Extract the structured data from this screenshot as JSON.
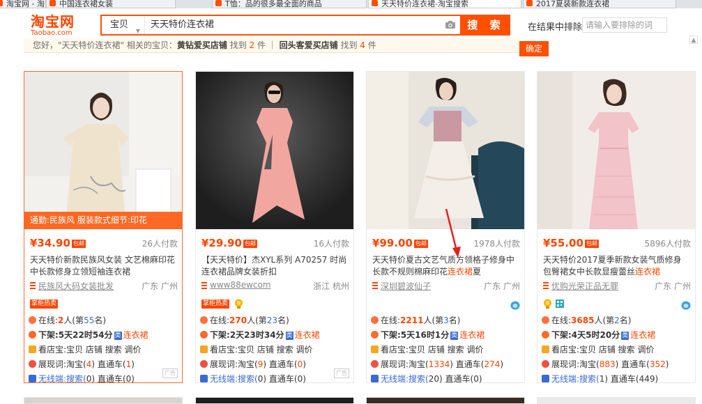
{
  "browser": {
    "tabs": [
      {
        "label": "淘宝网 - 淘！我喜欢"
      },
      {
        "label": "中国连衣裙女装"
      },
      {
        "label": "T恤：品的很多最全面的商品"
      },
      {
        "label": "天天特价连衣裙-淘宝搜索"
      },
      {
        "label": "2017夏装新款连衣裙"
      }
    ]
  },
  "header": {
    "logo_cn": "淘宝网",
    "logo_en": "Taobao.com",
    "search_type": "宝贝",
    "search_value": "天天特价连衣裙",
    "search_button": "搜 索",
    "exclude_label": "在结果中排除",
    "exclude_placeholder": "请输入要排除的词",
    "confirm_button": "确定"
  },
  "notice": {
    "prefix": "您好，\"天天特价连衣裙\" 相关的宝贝：",
    "label1": "黄钻爱买店铺",
    "mid1": " 找到 ",
    "count1": "2",
    "suffix1": " 件 ｜ ",
    "label2": "回头客爱买店铺",
    "mid2": " 找到 ",
    "count2": "4",
    "suffix2": " 件"
  },
  "products": [
    {
      "tag": "通勤:民族风    服装款式细节:印花",
      "price": "¥34.90",
      "baoyou": "包邮",
      "sold": "26人付款",
      "title_line1": "天天特价新款民族风女装 文艺棉麻印花",
      "title_line2_a": "中长款修身立领短袖",
      "title_line2_kw": "连衣裙",
      "title_line2_b": "",
      "shop": "民族风大码女装批发",
      "location": "广东 广州",
      "hot": "掌柜热卖",
      "online_prefix": "在线:",
      "online_count": "2",
      "online_mid": "人(第",
      "online_rank": "55",
      "online_suffix": "名)",
      "offshelf": "下架:5天22时54分",
      "kind": "类",
      "category": "连衣裙",
      "tools": "看店宝:宝贝 店铺 搜索 调价",
      "show_prefix": "展现词:淘宝(",
      "show_count": "4",
      "show_mid": ") 直通车(",
      "show_zt": "1",
      "show_suffix": ")",
      "wireless_prefix": "无线端:搜索(",
      "wireless_count": "0",
      "wireless_mid": ") 直通车(",
      "wireless_zt": "0",
      "wireless_suffix": ")",
      "ad": "广告"
    },
    {
      "price": "¥29.90",
      "baoyou": "包邮",
      "sold": "16人付款",
      "title_line1": "【天天特价】杰XYL系列 A70257 时尚",
      "title_line2_a": "连衣裙品牌女装折扣",
      "title_line2_kw": "",
      "title_line2_b": "",
      "shop": "www88ewcom",
      "location": "浙江 杭州",
      "hot": "掌柜热卖",
      "online_prefix": "在线:",
      "online_count": "270",
      "online_mid": "人(第",
      "online_rank": "23",
      "online_suffix": "名)",
      "offshelf": "下架:2天23时34分",
      "kind": "类",
      "category": "连衣裙",
      "tools": "看店宝:宝贝 店铺 搜索 调价",
      "show_prefix": "展现词:淘宝(",
      "show_count": "9",
      "show_mid": ") 直通车(",
      "show_zt": "0",
      "show_suffix": ")",
      "wireless_prefix": "无线端:搜索(",
      "wireless_count": "0",
      "wireless_mid": ") 直通车(",
      "wireless_zt": "0",
      "wireless_suffix": ")",
      "ad": "广告"
    },
    {
      "price": "¥99.00",
      "baoyou": "包邮",
      "sold": "1978人付款",
      "title_line1": "天天特价夏古文艺气质方领格子修身中",
      "title_line2_a": "长款不规则棉麻印花",
      "title_line2_kw": "连衣裙",
      "title_line2_b": "夏",
      "shop": "深圳碧波仙子",
      "location": "广东 广州",
      "online_prefix": "在线:",
      "online_count": "2211",
      "online_mid": "人(第",
      "online_rank": "3",
      "online_suffix": "名)",
      "offshelf": "下架:5天16时1分",
      "kind": "类",
      "category": "连衣裙",
      "tools": "看店宝:宝贝 店铺 搜索 调价",
      "show_prefix": "展现词:淘宝(",
      "show_count": "1334",
      "show_mid": ") 直通车(",
      "show_zt": "274",
      "show_suffix": ")",
      "wireless_prefix": "无线端:搜索(",
      "wireless_count": "20",
      "wireless_mid": ") 直通车(",
      "wireless_zt": "0",
      "wireless_suffix": ")"
    },
    {
      "price": "¥55.00",
      "baoyou": "包邮",
      "sold": "5896人付款",
      "title_line1": "天天特价2017夏季新款女装气质修身",
      "title_line2_a": "包臀裙女中长款显瘦蕾丝",
      "title_line2_kw": "连衣裙",
      "title_line2_b": "",
      "shop": "优购光荣正品无罪",
      "location": "广东 广州",
      "online_prefix": "在线:",
      "online_count": "3685",
      "online_mid": "人(第",
      "online_rank": "2",
      "online_suffix": "名)",
      "offshelf": "下架:4天5时20分",
      "kind": "类",
      "category": "连衣裙",
      "tools": "看店宝:宝贝 店铺 搜索 调价",
      "show_prefix": "展现词:淘宝(",
      "show_count": "883",
      "show_mid": ") 直通车(",
      "show_zt": "352",
      "show_suffix": ")",
      "wireless_prefix": "无线端:搜索(",
      "wireless_count": "1",
      "wireless_mid": ") 直通车(",
      "wireless_zt": "449",
      "wireless_suffix": ")"
    }
  ],
  "colors": {
    "accent": "#ff5000",
    "price": "#ff4400",
    "link_blue": "#3a6ad4"
  }
}
